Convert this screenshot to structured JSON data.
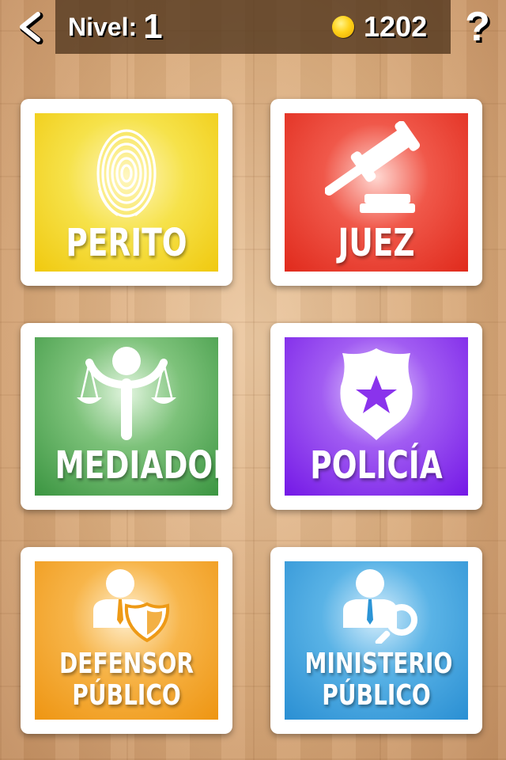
{
  "header": {
    "level_label": "Nivel:",
    "level_value": "1",
    "coins": "1202",
    "help_label": "?"
  },
  "cards": [
    {
      "label": "PERITO",
      "color": "#f0d616",
      "icon": "fingerprint-icon"
    },
    {
      "label": "JUEZ",
      "color": "#e12b1f",
      "icon": "gavel-icon"
    },
    {
      "label": "MEDIADOR",
      "color": "#3e9b43",
      "icon": "balance-person-icon"
    },
    {
      "label": "POLICÍA",
      "color": "#7a1ee8",
      "icon": "police-badge-icon"
    },
    {
      "label_line1": "DEFENSOR",
      "label_line2": "PÚBLICO",
      "color": "#ee9a16",
      "icon": "defender-shield-icon"
    },
    {
      "label_line1": "MINISTERIO",
      "label_line2": "PÚBLICO",
      "color": "#2b94d6",
      "icon": "prosecutor-magnifier-icon"
    }
  ]
}
